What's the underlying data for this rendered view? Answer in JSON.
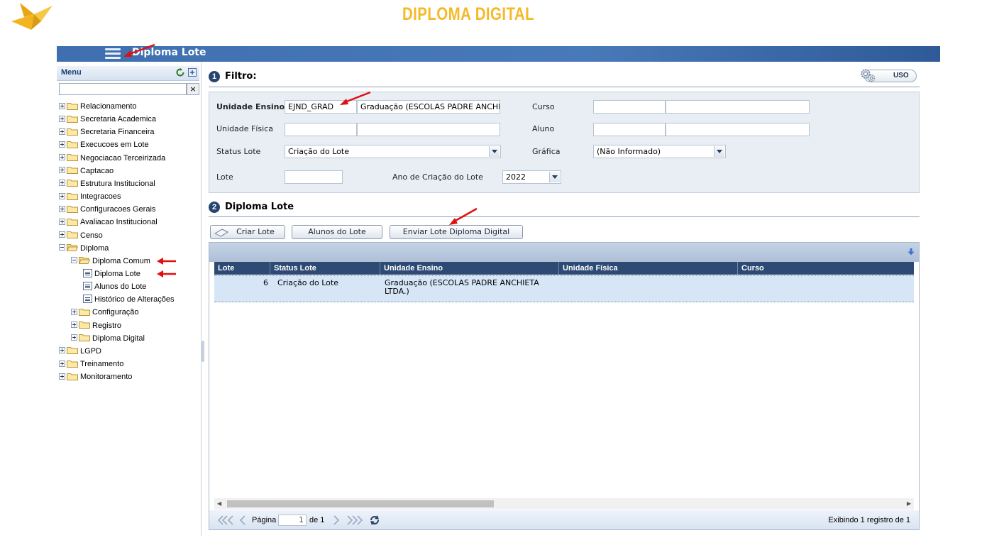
{
  "banner": {
    "title": "DIPLOMA DIGITAL"
  },
  "appbar": {
    "title": "Diploma Lote"
  },
  "menu": {
    "title": "Menu",
    "search_value": "",
    "clear_label": "×",
    "items": [
      {
        "label": "Relacionamento"
      },
      {
        "label": "Secretaria Academica"
      },
      {
        "label": "Secretaria Financeira"
      },
      {
        "label": "Execucoes em Lote"
      },
      {
        "label": "Negociacao Terceirizada"
      },
      {
        "label": "Captacao"
      },
      {
        "label": "Estrutura Institucional"
      },
      {
        "label": "Integracoes"
      },
      {
        "label": "Configuracoes Gerais"
      },
      {
        "label": "Avaliacao Institucional"
      },
      {
        "label": "Censo"
      },
      {
        "label": "Diploma"
      },
      {
        "label": "Diploma Comum"
      },
      {
        "label": "Diploma Lote"
      },
      {
        "label": "Alunos do Lote"
      },
      {
        "label": "Histórico de Alterações"
      },
      {
        "label": "Configuração"
      },
      {
        "label": "Registro"
      },
      {
        "label": "Diploma Digital"
      },
      {
        "label": "LGPD"
      },
      {
        "label": "Treinamento"
      },
      {
        "label": "Monitoramento"
      }
    ]
  },
  "filter": {
    "section_number": "1",
    "title": "Filtro:",
    "uso_label": "USO",
    "unidade_ensino_label": "Unidade Ensino",
    "unidade_ensino_code": "EJND_GRAD",
    "unidade_ensino_name": "Graduação (ESCOLAS PADRE ANCHIETA",
    "curso_label": "Curso",
    "curso_code": "",
    "curso_name": "",
    "unidade_fisica_label": "Unidade Física",
    "unidade_fisica_code": "",
    "unidade_fisica_name": "",
    "aluno_label": "Aluno",
    "aluno_code": "",
    "aluno_name": "",
    "status_lote_label": "Status Lote",
    "status_lote_value": "Criação do Lote",
    "grafica_label": "Gráfica",
    "grafica_value": "(Não Informado)",
    "lote_label": "Lote",
    "lote_value": "",
    "ano_label": "Ano de Criação do Lote",
    "ano_value": "2022"
  },
  "results": {
    "section_number": "2",
    "title": "Diploma Lote",
    "buttons": {
      "criar": "Criar Lote",
      "alunos": "Alunos do Lote",
      "enviar": "Enviar Lote Diploma Digital"
    },
    "columns": [
      "Lote",
      "Status Lote",
      "Unidade Ensino",
      "Unidade Física",
      "Curso"
    ],
    "rows": [
      {
        "lote": "6",
        "status": "Criação do Lote",
        "unidade_ensino": "Graduação (ESCOLAS PADRE ANCHIETA LTDA.)",
        "unidade_fisica": "",
        "curso": ""
      }
    ],
    "pager": {
      "page_label": "Página",
      "page_value": "1",
      "of_label": "de 1",
      "summary": "Exibindo 1 registro de 1"
    }
  },
  "colors": {
    "banner_title": "#f5b928",
    "appbar": "#4879b8",
    "grid_header": "#2c4a74",
    "selected_row": "#d6e6f7",
    "annotation_arrow": "#e01010"
  }
}
